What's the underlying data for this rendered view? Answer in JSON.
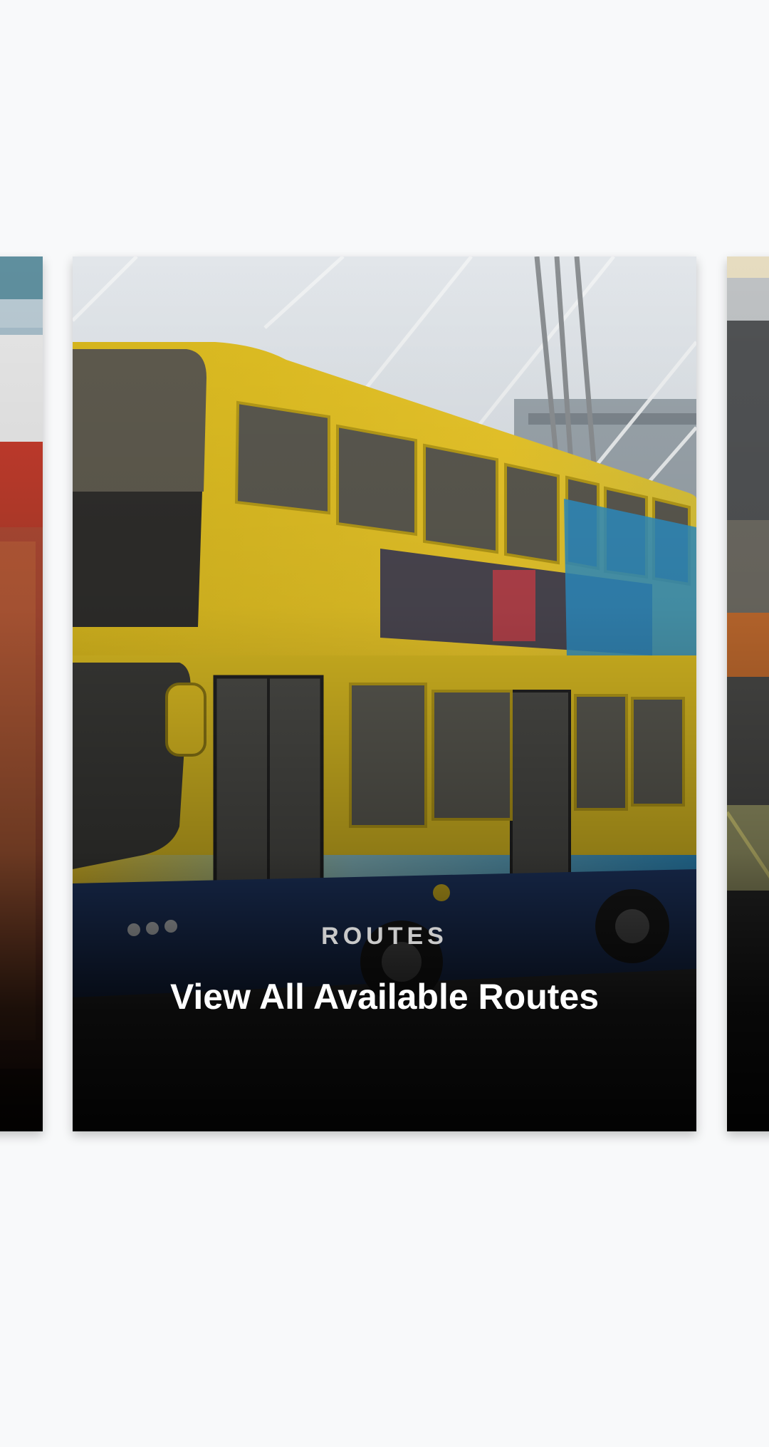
{
  "carousel": {
    "active_card": {
      "category": "ROUTES",
      "title": "View All Available Routes",
      "image": "double-decker-bus-photo"
    },
    "previous_card": {
      "image": "train-photo"
    },
    "next_card": {
      "image": "station-photo"
    }
  },
  "colors": {
    "background": "#f8f9fa",
    "bus_yellow": "#e9c62a",
    "bus_blue": "#213a6b",
    "bus_teal": "#3a9ac9"
  }
}
